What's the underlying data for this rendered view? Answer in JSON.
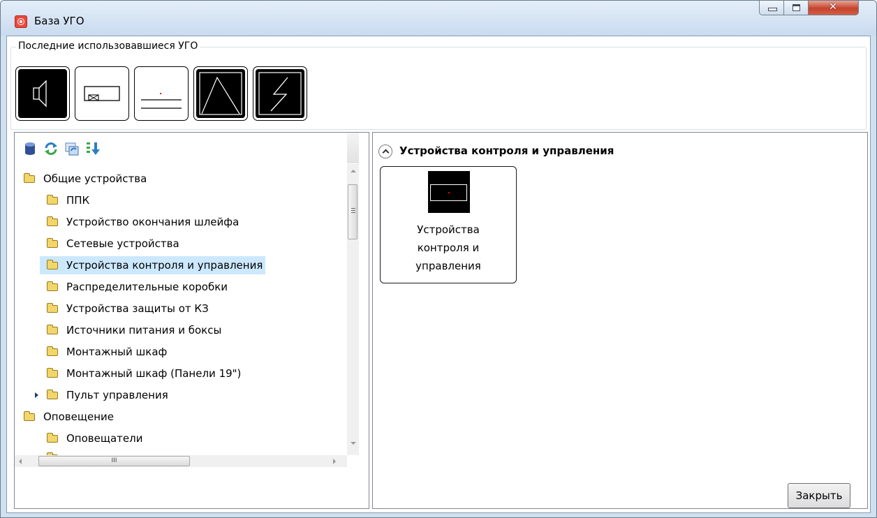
{
  "window": {
    "title": "База УГО",
    "app_icon": "app-icon"
  },
  "recent_group": {
    "label": "Последние использовавшиеся УГО",
    "symbols": [
      "speaker-symbol",
      "box-with-cross-symbol",
      "panel-with-dot-symbol",
      "triangle-symbol",
      "lightning-symbol"
    ]
  },
  "toolbar": {
    "icons": [
      "database-icon",
      "refresh-icon",
      "sync-icon",
      "sort-icon"
    ]
  },
  "tree": {
    "items": [
      {
        "label": "Общие устройства",
        "level": 0
      },
      {
        "label": "ППК",
        "level": 1
      },
      {
        "label": "Устройство окончания шлейфа",
        "level": 1
      },
      {
        "label": "Сетевые устройства",
        "level": 1
      },
      {
        "label": "Устройства контроля и управления",
        "level": 1,
        "selected": true
      },
      {
        "label": "Распределительные коробки",
        "level": 1
      },
      {
        "label": "Устройства защиты от КЗ",
        "level": 1
      },
      {
        "label": "Источники питания и боксы",
        "level": 1
      },
      {
        "label": "Монтажный шкаф",
        "level": 1
      },
      {
        "label": "Монтажный шкаф (Панели 19\")",
        "level": 1
      },
      {
        "label": "Пульт управления",
        "level": 1,
        "collapsed_expander": true
      },
      {
        "label": "Оповещение",
        "level": 0
      },
      {
        "label": "Оповещатели",
        "level": 1
      }
    ],
    "hscroll_grip": "III"
  },
  "content": {
    "header": "Устройства контроля и управления",
    "cards": [
      {
        "label_line1": "Устройства",
        "label_line2": "контроля и",
        "label_line3": "управления"
      }
    ]
  },
  "footer": {
    "close_label": "Закрыть"
  },
  "colors": {
    "selection": "#cce8ff",
    "folder": "#f2d66b",
    "close_button": "#c4432d"
  }
}
